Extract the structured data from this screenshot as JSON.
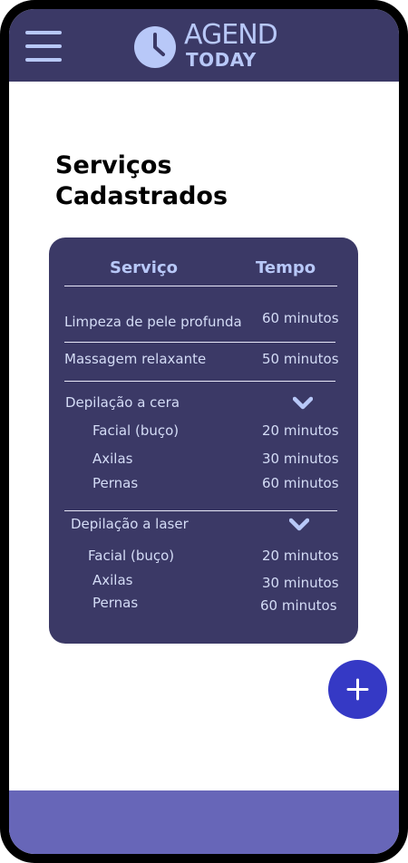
{
  "header": {
    "logo_line1": "AGEND",
    "logo_line2": "TODAY",
    "menu_icon": "hamburger-menu-icon",
    "clock_icon": "clock-icon"
  },
  "page": {
    "title": "Serviços Cadastrados"
  },
  "table": {
    "col_service": "Serviço",
    "col_time": "Tempo",
    "rows": [
      {
        "name": "Limpeza de pele profunda",
        "time": "60 minutos"
      },
      {
        "name": "Massagem relaxante",
        "time": "50 minutos"
      }
    ],
    "groups": [
      {
        "name": "Depilação a cera",
        "expanded": true,
        "items": [
          {
            "name": "Facial (buço)",
            "time": "20 minutos"
          },
          {
            "name": "Axilas",
            "time": "30 minutos"
          },
          {
            "name": "Pernas",
            "time": "60 minutos"
          }
        ]
      },
      {
        "name": "Depilação a laser",
        "expanded": true,
        "items": [
          {
            "name": "Facial (buço)",
            "time": "20 minutos"
          },
          {
            "name": "Axilas",
            "time": "30 minutos"
          },
          {
            "name": "Pernas",
            "time": "60 minutos"
          }
        ]
      }
    ]
  },
  "fab": {
    "icon": "plus-icon"
  },
  "colors": {
    "header_bg": "#3b3966",
    "accent_light": "#b8c8f8",
    "card_bg": "#3b3966",
    "fab_bg": "#3539c5",
    "bottom_bar": "#6766b8"
  }
}
